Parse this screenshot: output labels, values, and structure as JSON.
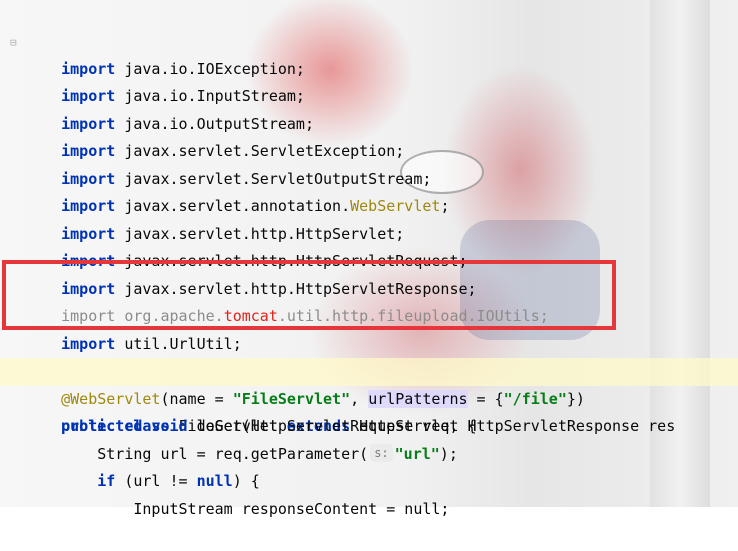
{
  "colors": {
    "keyword": "#0033b3",
    "annotation": "#9e880d",
    "string": "#067d17",
    "unused_import": "#8c8c8c",
    "highlight_word": "#e2231a",
    "red_box": "#e5373a"
  },
  "code": {
    "import_kw": "import",
    "imports": [
      "java.io.IOException;",
      "java.io.InputStream;",
      "java.io.OutputStream;",
      "javax.servlet.ServletException;",
      "javax.servlet.ServletOutputStream;"
    ],
    "ws_import_prefix": "javax.servlet.annotation.",
    "ws_import_ann": "WebServlet",
    "ws_import_suffix": ";",
    "imports2": [
      "javax.servlet.http.HttpServlet;",
      "javax.servlet.http.HttpServletRequest;",
      "javax.servlet.http.HttpServletResponse;"
    ],
    "ioutils_a": "org.apache.",
    "ioutils_b": "tomcat",
    "ioutils_c": ".util.http.fileupload.IOUtils;",
    "urlutil": "util.UrlUtil;",
    "annotation_name": "@WebServlet",
    "ann_open": "(name = ",
    "ann_name_val": "\"FileServlet\"",
    "ann_comma": ", ",
    "ann_urlpatterns": "urlPatterns",
    "ann_eq": " = {",
    "ann_url_val": "\"/file\"",
    "ann_close": "})",
    "kw_public": "public",
    "kw_class": "class",
    "class_name": "FileServlet",
    "kw_extends": "extends",
    "class_tail": "HttpServlet {",
    "kw_protected": "protected",
    "kw_void": "void",
    "method_sig": "doGet(HttpServletRequest req, HttpServletResponse res",
    "stmt_string": "String url = req.getParameter(",
    "param_hint": "s:",
    "stmt_url_arg": "\"url\"",
    "stmt_end": ");",
    "kw_if": "if",
    "if_mid": "(url != ",
    "kw_null": "null",
    "if_end": ") {",
    "partial_line": "InputStream responseContent = null;"
  }
}
